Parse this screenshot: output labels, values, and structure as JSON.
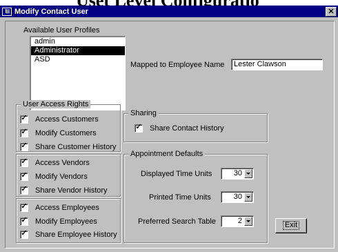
{
  "header_fragment": "Uset Level Configuratio",
  "window": {
    "title": "Modify Contact User",
    "close_glyph": "✕"
  },
  "profiles": {
    "legend": "Available User Profiles",
    "items": [
      "admin",
      "Administrator",
      "ASD"
    ],
    "selected_index": 1
  },
  "mapped": {
    "label": "Mapped to Employee Name",
    "value": "Lester Clawson"
  },
  "access_rights": {
    "legend": "User Access Rights",
    "customers": [
      {
        "label": "Access Customers",
        "checked": true
      },
      {
        "label": "Modify Customers",
        "checked": true
      },
      {
        "label": "Share Customer History",
        "checked": true
      }
    ],
    "vendors": [
      {
        "label": "Access Vendors",
        "checked": true
      },
      {
        "label": "Modify Vendors",
        "checked": true
      },
      {
        "label": "Share Vendor History",
        "checked": true
      }
    ],
    "employees": [
      {
        "label": "Access Employees",
        "checked": true
      },
      {
        "label": "Modify Employees",
        "checked": true
      },
      {
        "label": "Share Employee History",
        "checked": true
      }
    ]
  },
  "sharing": {
    "legend": "Sharing",
    "share_contact": {
      "label": "Share Contact History",
      "checked": true
    }
  },
  "appointments": {
    "legend": "Appointment Defaults",
    "displayed": {
      "label": "Displayed Time Units",
      "value": "30"
    },
    "printed": {
      "label": "Printed Time Units",
      "value": "30"
    },
    "search": {
      "label": "Preferred Search Table",
      "value": "2"
    }
  },
  "exit_button": "Exit",
  "check_glyph": "✓"
}
